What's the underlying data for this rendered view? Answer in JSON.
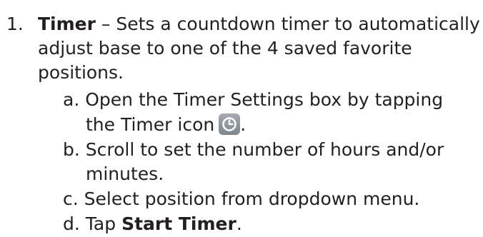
{
  "item": {
    "number": "1.",
    "title": "Timer",
    "dash": " – ",
    "description_line1": "Sets a countdown timer to automatically",
    "description_line2": "adjust base to one of the 4 saved favorite",
    "description_line3": "positions."
  },
  "steps": [
    {
      "letter": "a.",
      "line1": "Open the Timer Settings box by tapping",
      "line2": "the Timer icon",
      "icon": "clock-icon",
      "after_icon": "."
    },
    {
      "letter": "b.",
      "line1": "Scroll to set the number of hours and/or",
      "line2": "minutes."
    },
    {
      "letter": "c.",
      "line1": "Select position from dropdown menu."
    },
    {
      "letter": "d.",
      "prefix": "Tap ",
      "bold": "Start Timer",
      "suffix": "."
    }
  ],
  "colors": {
    "text": "#231f20",
    "icon_background": "#8e9499",
    "icon_foreground": "#ffffff"
  }
}
